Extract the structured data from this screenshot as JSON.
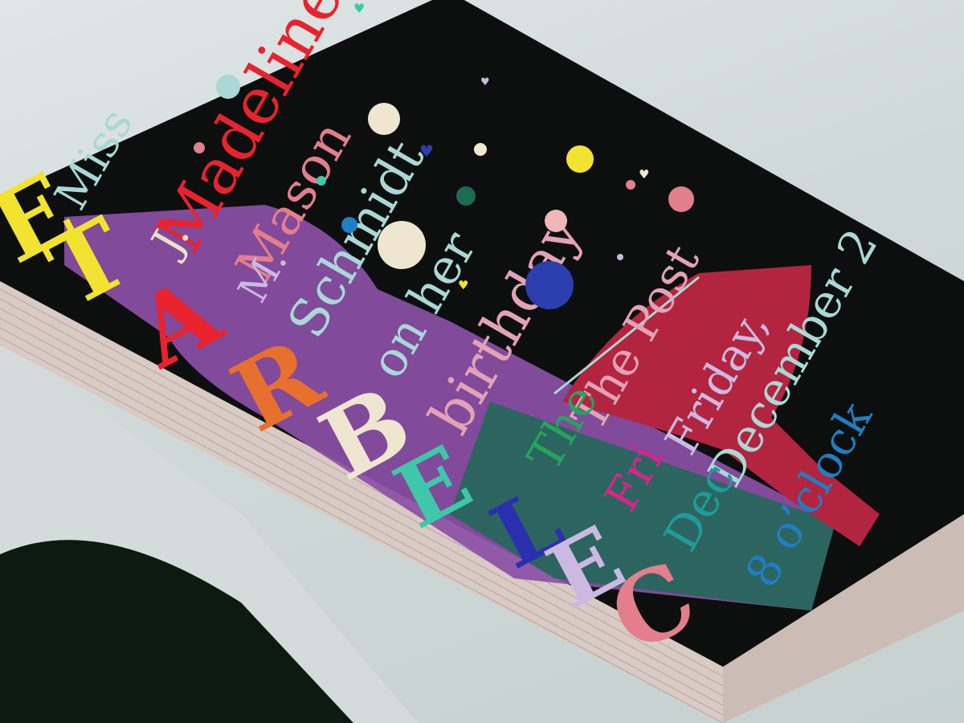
{
  "invitation": {
    "lines": [
      {
        "text": "Miss",
        "color": "#a9d8d6"
      },
      {
        "text": "Madeline",
        "color": "#e8232e"
      },
      {
        "text": "J.",
        "color": "#e8e2c8"
      },
      {
        "text": "Mason",
        "color": "#e37e8c"
      },
      {
        "text": "M.",
        "color": "#cbb9e2"
      },
      {
        "text": "Schmidt",
        "color": "#a9d8d6"
      },
      {
        "text": "on her",
        "color": "#a9d8d6"
      },
      {
        "text": "birthday",
        "color": "#e3a2b6"
      },
      {
        "text": "The Post",
        "color": "#e3a2b6"
      },
      {
        "text": "The",
        "color": "#27a35e"
      },
      {
        "text": "Friday,",
        "color": "#cbb9e2"
      },
      {
        "text": "Fri",
        "color": "#d8248a"
      },
      {
        "text": "December 2",
        "color": "#a9d8d6"
      },
      {
        "text": "Dec",
        "color": "#1f9c9a"
      },
      {
        "text": "8 o’clock",
        "color": "#1e7fc4"
      }
    ],
    "block_letters": [
      "E",
      "T",
      "A",
      "R",
      "B",
      "E",
      "L",
      "E",
      "C"
    ]
  },
  "colors": {
    "card": "#0c0f0e",
    "card_edge": "#dcd2cc",
    "bottle": "#8c4fa6",
    "glass": "#b3243f",
    "yellow": "#f1e32f",
    "red": "#e8232e"
  }
}
